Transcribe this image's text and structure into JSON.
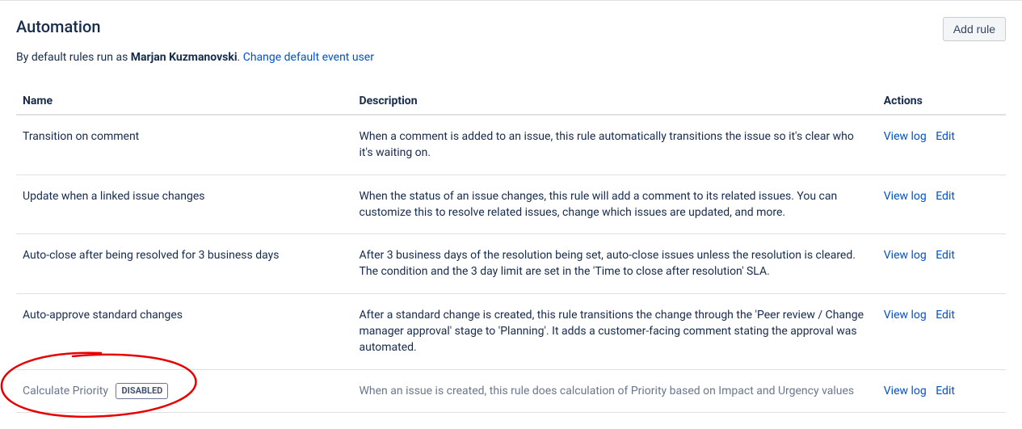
{
  "header": {
    "title": "Automation",
    "add_button": "Add rule",
    "sub_prefix": "By default rules run as ",
    "sub_user": "Marjan Kuzmanovski",
    "sub_suffix": ". ",
    "change_user_link": "Change default event user"
  },
  "table": {
    "columns": {
      "name": "Name",
      "description": "Description",
      "actions": "Actions"
    },
    "actions": {
      "view_log": "View log",
      "edit": "Edit"
    },
    "badge_disabled": "DISABLED",
    "rows": [
      {
        "name": "Transition on comment",
        "description": "When a comment is added to an issue, this rule automatically transitions the issue so it's clear who it's waiting on.",
        "disabled": false
      },
      {
        "name": "Update when a linked issue changes",
        "description": "When the status of an issue changes, this rule will add a comment to its related issues. You can customize this to resolve related issues, change which issues are updated, and more.",
        "disabled": false
      },
      {
        "name": "Auto-close after being resolved for 3 business days",
        "description": "After 3 business days of the resolution being set, auto-close issues unless the resolution is cleared. The condition and the 3 day limit are set in the 'Time to close after resolution' SLA.",
        "disabled": false
      },
      {
        "name": "Auto-approve standard changes",
        "description": "After a standard change is created, this rule transitions the change through the 'Peer review / Change manager approval' stage to 'Planning'. It adds a customer-facing comment stating the approval was automated.",
        "disabled": false
      },
      {
        "name": "Calculate Priority",
        "description": "When an issue is created, this rule does calculation of Priority based on Impact and Urgency values",
        "disabled": true
      }
    ]
  }
}
